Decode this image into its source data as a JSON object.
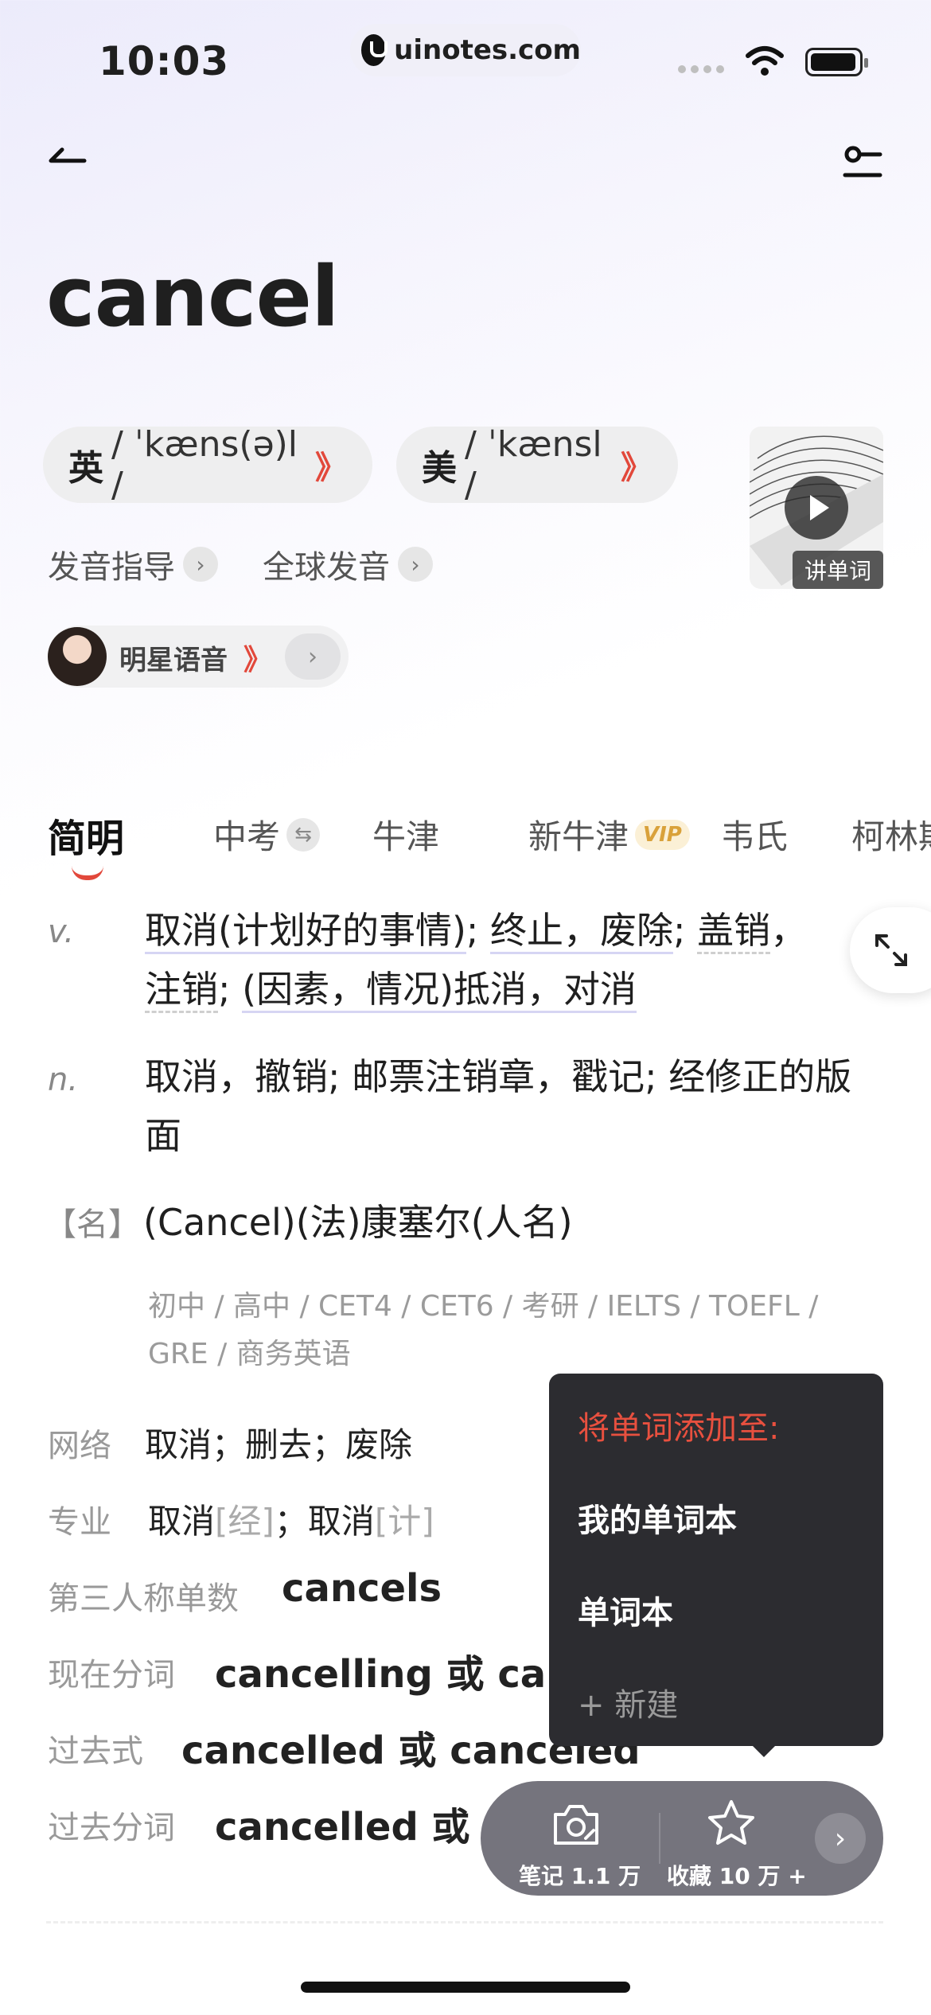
{
  "status": {
    "time": "10:03",
    "url": "uinotes.com"
  },
  "word": "cancel",
  "pron": [
    {
      "lang": "英",
      "ipa": " / ˈkæns(ə)l / ",
      "speaker": "》"
    },
    {
      "lang": "美",
      "ipa": " / ˈkænsl / ",
      "speaker": "》"
    }
  ],
  "video_label": "讲单词",
  "links": {
    "guide": "发音指导",
    "global": "全球发音"
  },
  "star_voice": {
    "label": "明星语音",
    "speaker": "》"
  },
  "tabs": [
    "简明",
    "中考",
    "牛津",
    "新牛津",
    "韦氏",
    "柯林斯"
  ],
  "vip": "VIP",
  "defs": {
    "v_pos": "v.",
    "v_parts": [
      "取消(计划好的事情)",
      "; ",
      "终止，废除",
      "; ",
      "盖销",
      "，",
      "注销",
      "; ",
      "(因素，情况)抵消，对消"
    ],
    "n_pos": "n.",
    "n_text": "取消，撤销; 邮票注销章，戳记; 经修正的版面",
    "name_tag": "【名】",
    "name_text": "(Cancel)(法)康塞尔(人名)"
  },
  "levels": "初中 / 高中 / CET4 / CET6 / 考研 / IELTS / TOEFL / GRE / 商务英语",
  "rows": {
    "web_label": "网络",
    "web_value": "取消；删去；废除",
    "pro_label": "专业",
    "pro_v1": "取消",
    "pro_t1": "[经]",
    "pro_sep": "；",
    "pro_v2": "取消",
    "pro_t2": "[计]"
  },
  "inflections": [
    {
      "label": "第三人称单数",
      "value": "cancels"
    },
    {
      "label": "现在分词",
      "value": "cancelling 或 cancel"
    },
    {
      "label": "过去式",
      "value": "cancelled 或 canceled"
    },
    {
      "label": "过去分词",
      "value": "cancelled 或 ca"
    }
  ],
  "popup": {
    "title": "将单词添加至:",
    "items": [
      "我的单词本",
      "单词本"
    ],
    "new": "+ 新建"
  },
  "actions": {
    "note": "笔记 1.1 万",
    "collect": "收藏 10 万 +",
    "next": "›"
  },
  "colors": {
    "accent_red": "#e2483b",
    "popup_bg": "#2c2c30",
    "action_bar": "#75747d"
  }
}
